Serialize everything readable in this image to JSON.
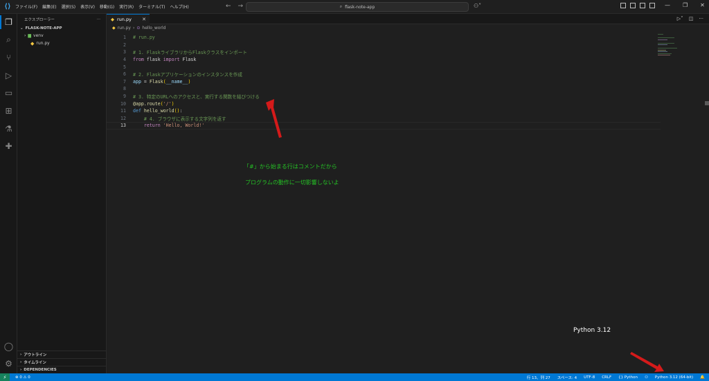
{
  "titlebar": {
    "menu": [
      "ファイル(F)",
      "編集(E)",
      "選択(S)",
      "表示(V)",
      "移動(G)",
      "実行(R)",
      "ターミナル(T)",
      "ヘルプ(H)"
    ],
    "search_text": "flask-note-app"
  },
  "sidebar": {
    "title": "エクスプローラー",
    "more": "···",
    "folder": "FLASK-NOTE-APP",
    "items": [
      {
        "label": "venv",
        "icon": "folder-icon"
      },
      {
        "label": "run.py",
        "icon": "python-file-icon"
      }
    ],
    "sections": [
      "アウトライン",
      "タイムライン",
      "DEPENDENCIES"
    ]
  },
  "editor": {
    "tab_label": "run.py",
    "breadcrumb": [
      "run.py",
      "hello_world"
    ],
    "lines": [
      {
        "n": "1",
        "tokens": [
          [
            "c-com",
            "# run.py"
          ]
        ]
      },
      {
        "n": "2",
        "tokens": []
      },
      {
        "n": "3",
        "tokens": [
          [
            "c-com",
            "# 1. FlaskライブラリからFlaskクラスをインポート"
          ]
        ]
      },
      {
        "n": "4",
        "tokens": [
          [
            "c-kw",
            "from"
          ],
          [
            "c-txt",
            " flask "
          ],
          [
            "c-kw",
            "import"
          ],
          [
            "c-txt",
            " Flask"
          ]
        ]
      },
      {
        "n": "5",
        "tokens": []
      },
      {
        "n": "6",
        "tokens": [
          [
            "c-com",
            "# 2. Flaskアプリケーションのインスタンスを作成"
          ]
        ]
      },
      {
        "n": "7",
        "tokens": [
          [
            "c-var",
            "app"
          ],
          [
            "c-txt",
            " = "
          ],
          [
            "c-fn",
            "Flask"
          ],
          [
            "c-brk",
            "("
          ],
          [
            "c-var",
            "__name__"
          ],
          [
            "c-brk",
            ")"
          ]
        ]
      },
      {
        "n": "8",
        "tokens": []
      },
      {
        "n": "9",
        "tokens": [
          [
            "c-com",
            "# 3. 特定のURLへのアクセスと、実行する関数を結びつける"
          ]
        ]
      },
      {
        "n": "10",
        "tokens": [
          [
            "c-dec",
            "@app.route"
          ],
          [
            "c-brk",
            "("
          ],
          [
            "c-str",
            "'/'"
          ],
          [
            "c-brk",
            ")"
          ]
        ]
      },
      {
        "n": "11",
        "tokens": [
          [
            "c-def",
            "def"
          ],
          [
            "c-txt",
            " "
          ],
          [
            "c-fn",
            "hello_world"
          ],
          [
            "c-brk",
            "()"
          ],
          [
            "c-txt",
            ":"
          ]
        ]
      },
      {
        "n": "12",
        "tokens": [
          [
            "c-txt",
            "    "
          ],
          [
            "c-com",
            "# 4. ブラウザに表示する文字列を返す"
          ]
        ]
      },
      {
        "n": "13",
        "tokens": [
          [
            "c-txt",
            "    "
          ],
          [
            "c-kw",
            "return"
          ],
          [
            "c-txt",
            " "
          ],
          [
            "c-str",
            "'Hello, World!'"
          ]
        ]
      }
    ]
  },
  "annotations": {
    "line1": "「#」から始まる行はコメントだから",
    "line2": "プログラムの動作に一切影響しないよ",
    "python_label": "Python 3.12",
    "arrow_color": "#d41a1a"
  },
  "statusbar": {
    "problems": "⊗ 0 ⚠ 0",
    "position": "行 13、列 27",
    "spaces": "スペース: 4",
    "encoding": "UTF-8",
    "eol": "CRLF",
    "language": "Python",
    "interpreter": "Python 3.12 (64-bit)"
  }
}
